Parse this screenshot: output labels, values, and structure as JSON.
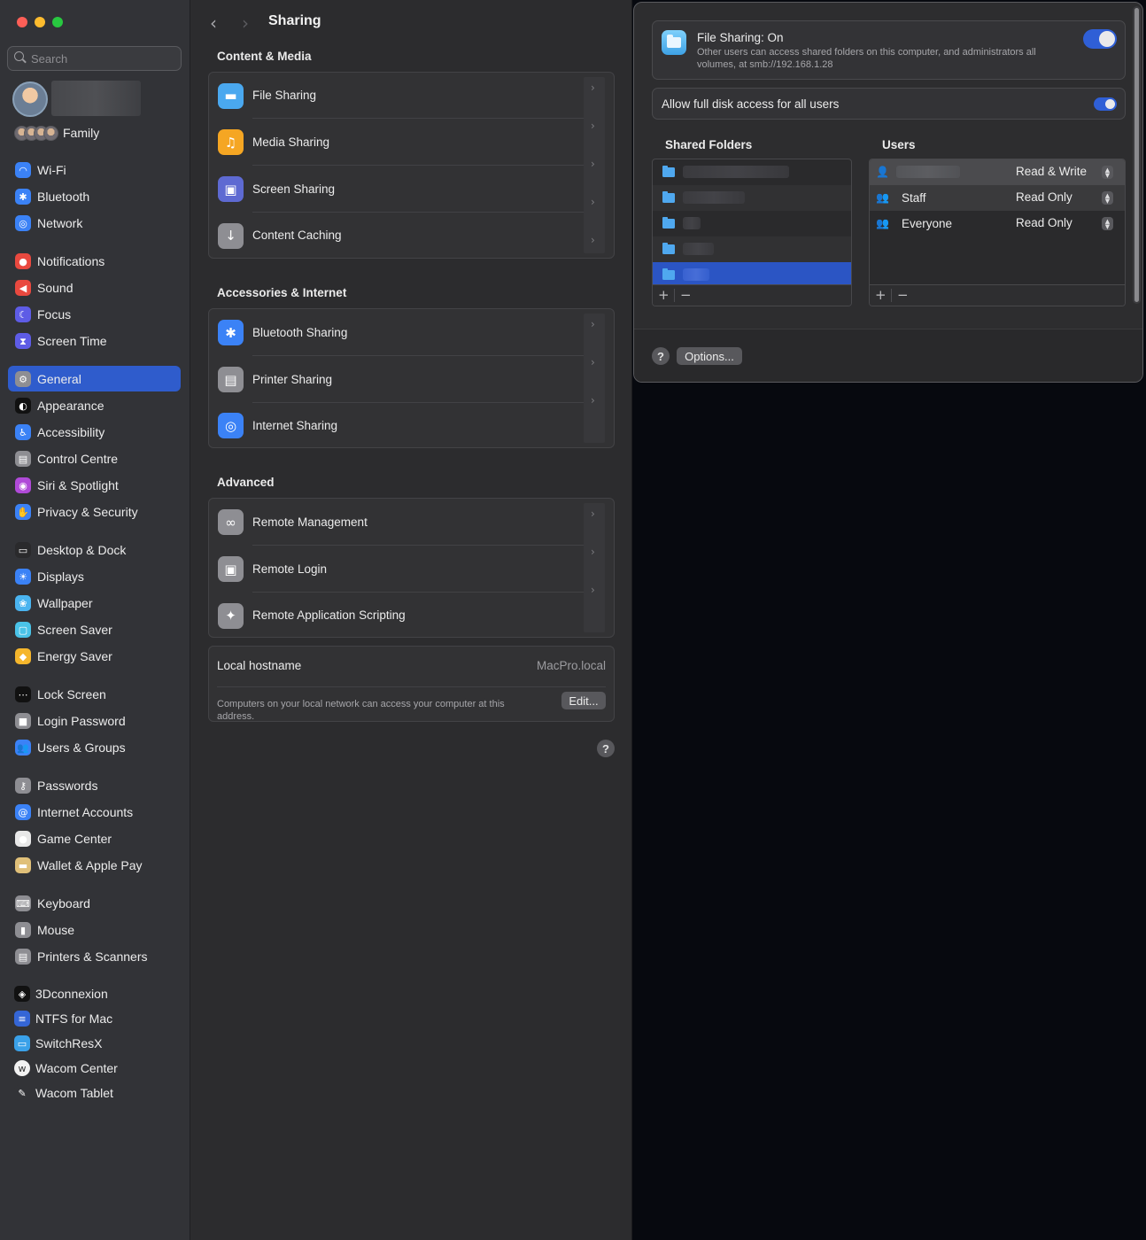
{
  "colors": {
    "accent": "#2f5ccc",
    "toggle_on": "#2f5fd6",
    "sidebar_bg": "#323337",
    "pane_bg": "#2c2c2e"
  },
  "sidebar": {
    "search_placeholder": "Search",
    "family_label": "Family",
    "items": [
      {
        "label": "Wi-Fi",
        "icon": "wifi-icon",
        "color": "#3b82f6",
        "glyph": "◠"
      },
      {
        "label": "Bluetooth",
        "icon": "bluetooth-icon",
        "color": "#3b82f6",
        "glyph": "✱"
      },
      {
        "label": "Network",
        "icon": "globe-icon",
        "color": "#3b82f6",
        "glyph": "◎"
      },
      {
        "label": "Notifications",
        "icon": "bell-icon",
        "color": "#e9493f",
        "glyph": "●"
      },
      {
        "label": "Sound",
        "icon": "speaker-icon",
        "color": "#e9493f",
        "glyph": "◀"
      },
      {
        "label": "Focus",
        "icon": "moon-icon",
        "color": "#5e5ce6",
        "glyph": "☾"
      },
      {
        "label": "Screen Time",
        "icon": "hourglass-icon",
        "color": "#5e5ce6",
        "glyph": "⧗"
      },
      {
        "label": "General",
        "icon": "gear-icon",
        "color": "#8e8e93",
        "glyph": "⚙",
        "selected": true
      },
      {
        "label": "Appearance",
        "icon": "appearance-icon",
        "color": "#111111",
        "glyph": "◐"
      },
      {
        "label": "Accessibility",
        "icon": "accessibility-icon",
        "color": "#3b82f6",
        "glyph": "♿"
      },
      {
        "label": "Control Centre",
        "icon": "control-centre-icon",
        "color": "#8e8e93",
        "glyph": "▤"
      },
      {
        "label": "Siri & Spotlight",
        "icon": "siri-icon",
        "color": "#b04ad8",
        "glyph": "◉"
      },
      {
        "label": "Privacy & Security",
        "icon": "hand-icon",
        "color": "#3b82f6",
        "glyph": "✋"
      },
      {
        "label": "Desktop & Dock",
        "icon": "dock-icon",
        "color": "#2a2a2c",
        "glyph": "▭"
      },
      {
        "label": "Displays",
        "icon": "sun-icon",
        "color": "#3b82f6",
        "glyph": "☀"
      },
      {
        "label": "Wallpaper",
        "icon": "wallpaper-icon",
        "color": "#4ab4f0",
        "glyph": "❀"
      },
      {
        "label": "Screen Saver",
        "icon": "screen-saver-icon",
        "color": "#4ac3e8",
        "glyph": "▢"
      },
      {
        "label": "Energy Saver",
        "icon": "bulb-icon",
        "color": "#f5b62c",
        "glyph": "◆"
      },
      {
        "label": "Lock Screen",
        "icon": "lock-screen-icon",
        "color": "#111111",
        "glyph": "⋯"
      },
      {
        "label": "Login Password",
        "icon": "lock-icon",
        "color": "#8e8e93",
        "glyph": "■"
      },
      {
        "label": "Users & Groups",
        "icon": "users-icon",
        "color": "#3b82f6",
        "glyph": "👥"
      },
      {
        "label": "Passwords",
        "icon": "key-icon",
        "color": "#8e8e93",
        "glyph": "⚷"
      },
      {
        "label": "Internet Accounts",
        "icon": "at-icon",
        "color": "#3b82f6",
        "glyph": "@"
      },
      {
        "label": "Game Center",
        "icon": "game-center-icon",
        "color": "#e8e8e8",
        "glyph": "●"
      },
      {
        "label": "Wallet & Apple Pay",
        "icon": "wallet-icon",
        "color": "#e0c079",
        "glyph": "▬"
      },
      {
        "label": "Keyboard",
        "icon": "keyboard-icon",
        "color": "#8e8e93",
        "glyph": "⌨"
      },
      {
        "label": "Mouse",
        "icon": "mouse-icon",
        "color": "#8e8e93",
        "glyph": "▮"
      },
      {
        "label": "Printers & Scanners",
        "icon": "printer-icon",
        "color": "#8e8e93",
        "glyph": "▤"
      }
    ],
    "third_party": [
      {
        "label": "3Dconnexion",
        "icon": "3dconnexion-icon",
        "color": "#111111",
        "glyph": "◈"
      },
      {
        "label": "NTFS for Mac",
        "icon": "ntfs-icon",
        "color": "#3566d6",
        "glyph": "≡"
      },
      {
        "label": "SwitchResX",
        "icon": "monitor-icon",
        "color": "#3aa1e9",
        "glyph": "▭"
      },
      {
        "label": "Wacom Center",
        "icon": "wacom-icon",
        "color": "#f2f2f2",
        "glyph": "w"
      },
      {
        "label": "Wacom Tablet",
        "icon": "pen-icon",
        "color": "#323337",
        "glyph": "✎"
      }
    ]
  },
  "main": {
    "title": "Sharing",
    "sections": [
      {
        "heading": "Content & Media",
        "rows": [
          {
            "label": "File Sharing",
            "icon": "folder-icon",
            "color": "#4aa8ef",
            "glyph": "▬"
          },
          {
            "label": "Media Sharing",
            "icon": "media-sharing-icon",
            "color": "#f5a623",
            "glyph": "♫"
          },
          {
            "label": "Screen Sharing",
            "icon": "screen-sharing-icon",
            "color": "#5e6ad2",
            "glyph": "▣"
          },
          {
            "label": "Content Caching",
            "icon": "content-caching-icon",
            "color": "#8e8e93",
            "glyph": "↓"
          }
        ]
      },
      {
        "heading": "Accessories & Internet",
        "rows": [
          {
            "label": "Bluetooth Sharing",
            "icon": "bluetooth-sharing-icon",
            "color": "#3b82f6",
            "glyph": "✱"
          },
          {
            "label": "Printer Sharing",
            "icon": "printer-sharing-icon",
            "color": "#8e8e93",
            "glyph": "▤"
          },
          {
            "label": "Internet Sharing",
            "icon": "internet-sharing-icon",
            "color": "#3b82f6",
            "glyph": "◎"
          }
        ]
      },
      {
        "heading": "Advanced",
        "rows": [
          {
            "label": "Remote Management",
            "icon": "binoculars-icon",
            "color": "#8e8e93",
            "glyph": "∞"
          },
          {
            "label": "Remote Login",
            "icon": "terminal-icon",
            "color": "#8e8e93",
            "glyph": "▣"
          },
          {
            "label": "Remote Application Scripting",
            "icon": "script-icon",
            "color": "#8e8e93",
            "glyph": "✦"
          }
        ]
      }
    ],
    "hostname": {
      "label": "Local hostname",
      "value": "MacPro.local",
      "description": "Computers on your local network can access your computer at this address.",
      "edit_label": "Edit..."
    },
    "help_label": "?"
  },
  "sheet": {
    "file_sharing_title": "File Sharing: On",
    "file_sharing_desc": "Other users can access shared folders on this computer, and administrators all volumes, at smb://192.168.1.28",
    "file_sharing_on": true,
    "full_disk_label": "Allow full disk access for all users",
    "full_disk_on": true,
    "shared_folders_heading": "Shared Folders",
    "users_heading": "Users",
    "folders_count_visible": 5,
    "selected_folder_index": 4,
    "users": [
      {
        "name": "",
        "permission": "Read & Write",
        "icon": "user-icon",
        "glyph": "👤"
      },
      {
        "name": "Staff",
        "permission": "Read Only",
        "icon": "group-icon",
        "glyph": "👥"
      },
      {
        "name": "Everyone",
        "permission": "Read Only",
        "icon": "everyone-icon",
        "glyph": "👥"
      }
    ],
    "add_label": "+",
    "remove_label": "−",
    "help_label": "?",
    "options_label": "Options..."
  }
}
